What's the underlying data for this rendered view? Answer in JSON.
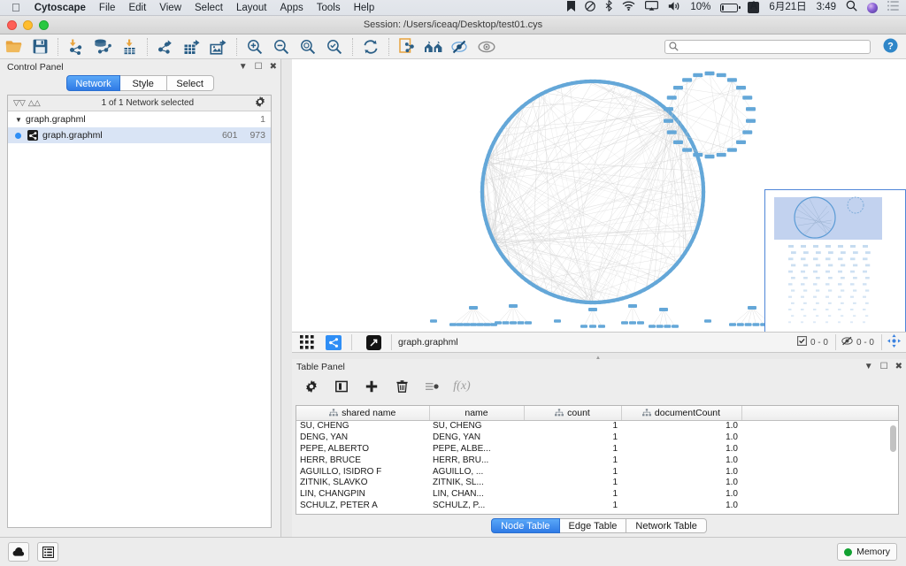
{
  "macbar": {
    "apple_icon": "apple-icon",
    "app_name": "Cytoscape",
    "menus": [
      "File",
      "Edit",
      "View",
      "Select",
      "Layout",
      "Apps",
      "Tools",
      "Help"
    ],
    "status_icons": [
      "bookmark-icon",
      "do-not-disturb-icon",
      "bluetooth-icon",
      "wifi-icon",
      "airplay-icon",
      "volume-icon"
    ],
    "battery_percent": "10%",
    "input_source": "A",
    "date": "6月21日",
    "time": "3:49",
    "search_icon": "spotlight-search-icon",
    "siri_icon": "siri-icon",
    "notification_icon": "notification-center-icon"
  },
  "window": {
    "title": "Session: /Users/iceaq/Desktop/test01.cys",
    "close_label": "close-button",
    "minimize_label": "minimize-button",
    "zoom_label": "zoom-button"
  },
  "toolbar": {
    "buttons": [
      {
        "name": "open-session-icon",
        "tip": "Open Session"
      },
      {
        "name": "save-session-icon",
        "tip": "Save Session"
      },
      {
        "name": "import-network-icon",
        "tip": "Import Network From File"
      },
      {
        "name": "import-network-database-icon",
        "tip": "Import Network From Database"
      },
      {
        "name": "import-table-icon",
        "tip": "Import Table From File"
      },
      {
        "name": "export-network-icon",
        "tip": "Export Network"
      },
      {
        "name": "export-table-icon",
        "tip": "Export Table"
      },
      {
        "name": "export-image-icon",
        "tip": "Export Image"
      },
      {
        "name": "zoom-in-icon",
        "tip": "Zoom In"
      },
      {
        "name": "zoom-out-icon",
        "tip": "Zoom Out"
      },
      {
        "name": "fit-network-icon",
        "tip": "Zoom Out to Display All"
      },
      {
        "name": "fit-selected-icon",
        "tip": "Zoom Selected Region"
      },
      {
        "name": "refresh-layout-icon",
        "tip": "Apply Preferred Layout"
      },
      {
        "name": "new-network-from-selection-icon",
        "tip": "New Network From Selection"
      },
      {
        "name": "first-neighbors-icon",
        "tip": "Select First Neighbors"
      },
      {
        "name": "hide-selected-icon",
        "tip": "Hide Selected"
      },
      {
        "name": "show-all-icon",
        "tip": "Show All"
      }
    ],
    "search_placeholder": "",
    "search_value": "",
    "search_icon": "search-icon",
    "help_icon": "help-icon"
  },
  "control_panel": {
    "title": "Control Panel",
    "float_icon": "float-panel-icon",
    "maximize_icon": "maximize-panel-icon",
    "close_icon": "close-panel-icon",
    "tabs": [
      {
        "label": "Network",
        "active": true
      },
      {
        "label": "Style",
        "active": false
      },
      {
        "label": "Select",
        "active": false
      }
    ],
    "status_text": "1 of 1 Network selected",
    "collapse_all_icon": "collapse-all-icon",
    "expand_all_icon": "expand-all-icon",
    "settings_icon": "gear-icon",
    "tree": [
      {
        "label": "graph.graphml",
        "type": "root",
        "nodes": "",
        "edges": "1",
        "expanded": true
      },
      {
        "label": "graph.graphml",
        "type": "child",
        "nodes": "601",
        "edges": "973",
        "selected": true
      }
    ]
  },
  "view_bar": {
    "grid_view_icon": "grid-view-icon",
    "network_view_icon": "network-view-icon",
    "detach_view_icon": "detach-view-icon",
    "network_name": "graph.graphml",
    "selected_counter_icon": "selected-elements-icon",
    "selected_counter": "0 - 0",
    "hidden_counter_icon": "hidden-elements-icon",
    "hidden_counter": "0 - 0",
    "navigate_icon": "navigator-toggle-icon"
  },
  "network_view": {
    "background": "#ffffff",
    "node_color": "#64a7d8",
    "edge_color": "#c9c9c9",
    "navigator_border": "#4f86d8",
    "navigator_selection": "#aec3ea"
  },
  "table_panel": {
    "title": "Table Panel",
    "float_icon": "float-panel-icon",
    "maximize_icon": "maximize-panel-icon",
    "close_icon": "close-panel-icon",
    "tools": [
      {
        "name": "table-settings-icon"
      },
      {
        "name": "toggle-columns-icon"
      },
      {
        "name": "add-column-icon"
      },
      {
        "name": "delete-column-icon"
      },
      {
        "name": "select-all-icon"
      },
      {
        "name": "function-builder-icon"
      }
    ],
    "columns": [
      {
        "label": "shared name",
        "has_icon": true
      },
      {
        "label": "name",
        "has_icon": false
      },
      {
        "label": "count",
        "has_icon": true
      },
      {
        "label": "documentCount",
        "has_icon": true
      }
    ],
    "rows": [
      {
        "shared_name": "SU, CHENG",
        "name": "SU, CHENG",
        "count": "1",
        "documentCount": "1.0"
      },
      {
        "shared_name": "DENG, YAN",
        "name": "DENG, YAN",
        "count": "1",
        "documentCount": "1.0"
      },
      {
        "shared_name": "PEPE, ALBERTO",
        "name": "PEPE, ALBE...",
        "count": "1",
        "documentCount": "1.0"
      },
      {
        "shared_name": "HERR, BRUCE",
        "name": "HERR, BRU...",
        "count": "1",
        "documentCount": "1.0"
      },
      {
        "shared_name": "AGUILLO, ISIDRO F",
        "name": "AGUILLO, ...",
        "count": "1",
        "documentCount": "1.0"
      },
      {
        "shared_name": "ZITNIK, SLAVKO",
        "name": "ZITNIK, SL...",
        "count": "1",
        "documentCount": "1.0"
      },
      {
        "shared_name": "LIN, CHANGPIN",
        "name": "LIN, CHAN...",
        "count": "1",
        "documentCount": "1.0"
      },
      {
        "shared_name": "SCHULZ, PETER A",
        "name": "SCHULZ, P...",
        "count": "1",
        "documentCount": "1.0"
      }
    ],
    "tabs": [
      {
        "label": "Node Table",
        "active": true
      },
      {
        "label": "Edge Table",
        "active": false
      },
      {
        "label": "Network Table",
        "active": false
      }
    ]
  },
  "status_bar": {
    "buttons": [
      {
        "name": "cloud-icon"
      },
      {
        "name": "task-list-icon"
      }
    ],
    "memory_label": "Memory",
    "memory_status_color": "#12a132"
  }
}
